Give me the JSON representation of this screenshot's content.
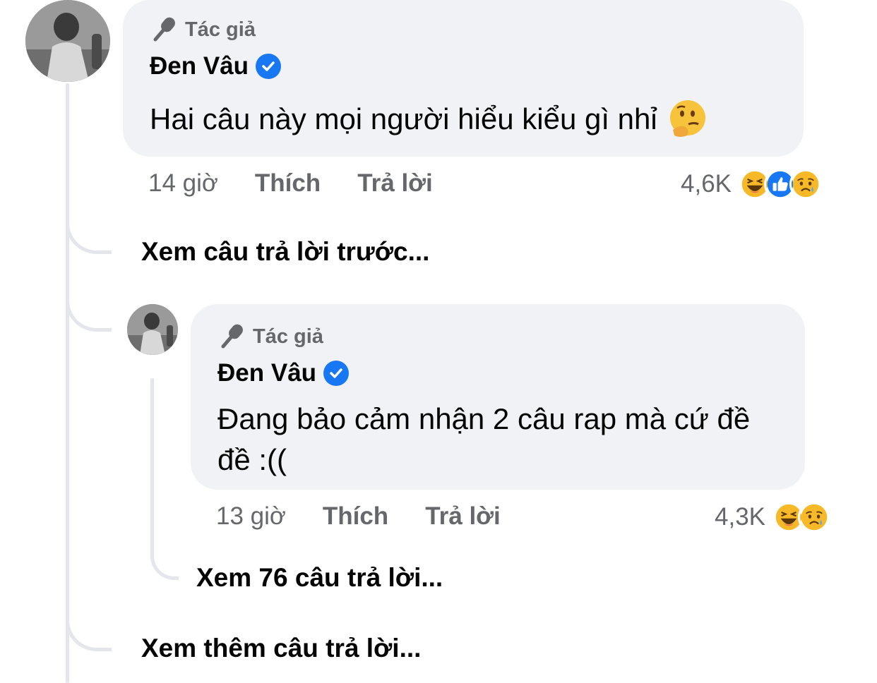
{
  "comments": [
    {
      "badge": "Tác giả",
      "author": "Đen Vâu",
      "text": "Hai câu này mọi người hiểu kiểu gì nhỉ",
      "emoji": "thinking-face-icon",
      "time": "14 giờ",
      "like": "Thích",
      "reply": "Trả lời",
      "reaction_count": "4,6K",
      "reactions": [
        "haha-icon",
        "like-icon",
        "sad-icon"
      ]
    },
    {
      "badge": "Tác giả",
      "author": "Đen Vâu",
      "text": "Đang bảo cảm nhận 2 câu rap mà cứ đề đề :((",
      "time": "13 giờ",
      "like": "Thích",
      "reply": "Trả lời",
      "reaction_count": "4,3K",
      "reactions": [
        "haha-icon",
        "sad-icon"
      ]
    }
  ],
  "links": {
    "previous_replies": "Xem câu trả lời trước...",
    "view_76_replies": "Xem 76 câu trả lời...",
    "more_replies": "Xem thêm câu trả lời..."
  },
  "colors": {
    "bubble": "#f0f2f5",
    "thread_line": "#e4e6eb",
    "verified": "#1877f2",
    "meta_text": "#65676b",
    "like_blue": "#1877f2",
    "haha_yellow": "#f7b928"
  }
}
